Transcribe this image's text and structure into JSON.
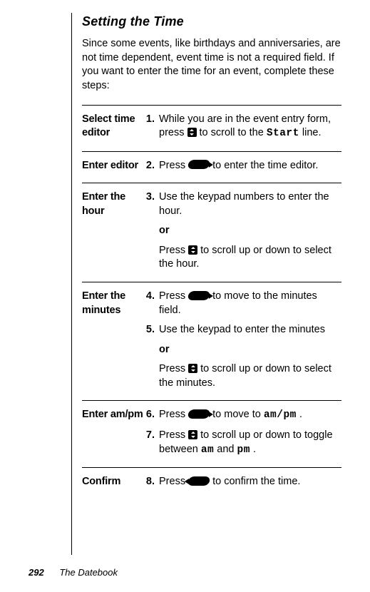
{
  "title": "Setting the Time",
  "intro": "Since some events, like birthdays and anniversaries, are not time dependent, event time is not a required field. If you want to enter the time for an event, complete these steps:",
  "rows": {
    "r1": {
      "label": "Select time editor",
      "s1_num": "1.",
      "s1_a": "While you are in the event entry form, press ",
      "s1_b": " to scroll to the ",
      "s1_code": "Start",
      "s1_c": " line."
    },
    "r2": {
      "label": "Enter editor",
      "s2_num": "2.",
      "s2_a": "Press ",
      "s2_b": " to enter the time editor."
    },
    "r3": {
      "label": "Enter the hour",
      "s3_num": "3.",
      "s3_a": "Use the keypad numbers to enter the hour.",
      "or": "or",
      "s3_b1": "Press ",
      "s3_b2": " to scroll up or down to select the hour."
    },
    "r4": {
      "label": "Enter the minutes",
      "s4_num": "4.",
      "s4_a": "Press ",
      "s4_b": " to move to the minutes field.",
      "s5_num": "5.",
      "s5_a": "Use the keypad to enter the minutes",
      "or": "or",
      "s5_b1": "Press ",
      "s5_b2": " to scroll up or down to select the minutes."
    },
    "r5": {
      "label": "Enter am/pm",
      "s6_num": "6.",
      "s6_a": "Press ",
      "s6_b": " to move to ",
      "s6_code": "am/pm",
      "s6_c": ".",
      "s7_num": "7.",
      "s7_a": "Press ",
      "s7_b": " to scroll up or down to toggle between ",
      "s7_code1": "am",
      "s7_mid": " and ",
      "s7_code2": "pm",
      "s7_c": "."
    },
    "r6": {
      "label": "Confirm",
      "s8_num": "8.",
      "s8_a": "Press ",
      "s8_b": " to confirm the time."
    }
  },
  "footer": {
    "page": "292",
    "section": "The Datebook"
  }
}
